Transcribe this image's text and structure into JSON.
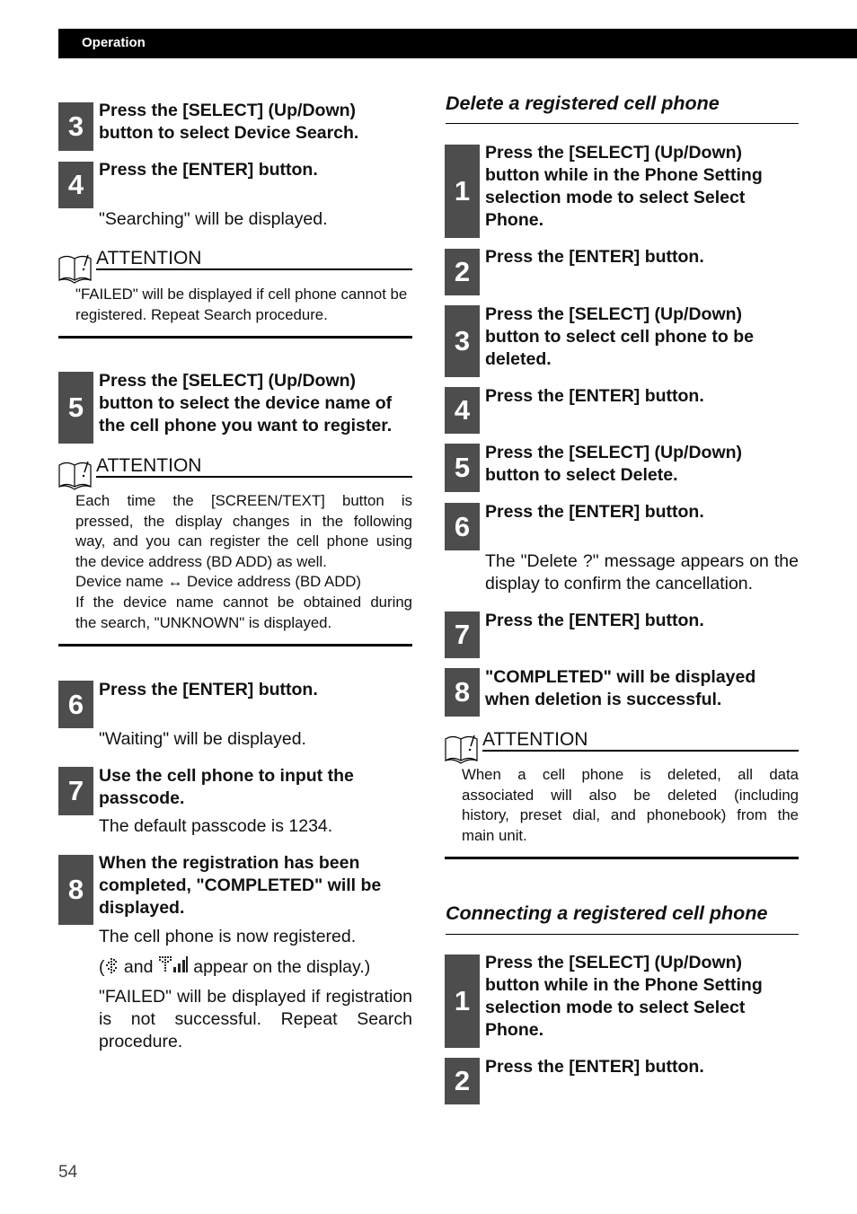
{
  "header": {
    "title": "Operation"
  },
  "left_column": {
    "steps": [
      {
        "number": "3",
        "text": "Press the [SELECT] (Up/Down) button to select Device Search."
      },
      {
        "number": "4",
        "text": "Press the [ENTER] button.",
        "note": "\"Searching\" will be displayed."
      },
      {
        "number": "5",
        "text": "Press the [SELECT] (Up/Down) button to select the device name of the cell phone you want to register."
      },
      {
        "number": "6",
        "text": "Press the [ENTER] button.",
        "note": "\"Waiting\" will be displayed."
      },
      {
        "number": "7",
        "text": "Use the cell phone to input the passcode.",
        "note": "The default passcode is 1234."
      },
      {
        "number": "8",
        "text": "When the registration has been completed, \"COMPLETED\" will be displayed.",
        "note": "The cell phone is now registered.",
        "icons_note": {
          "prefix": "(",
          "middle": " and ",
          "suffix": " appear on the display.)"
        },
        "note2": "\"FAILED\" will be displayed if registration is not successful. Repeat Search procedure."
      }
    ],
    "attention_1": {
      "label": "ATTENTION",
      "text": "\"FAILED\" will be displayed if cell phone cannot be registered. Repeat Search procedure."
    },
    "attention_2": {
      "label": "ATTENTION",
      "lines": [
        "Each time the [SCREEN/TEXT] button is",
        "pressed, the display changes in the following",
        "way, and you can register the cell phone using",
        "the device address (BD ADD) as well.",
        "Device name ↔ Device address (BD ADD)",
        "If the device name cannot be obtained during",
        "the search, \"UNKNOWN\" is displayed."
      ]
    }
  },
  "right_column": {
    "delete_section": {
      "title": "Delete a registered cell phone",
      "steps": [
        {
          "number": "1",
          "text": "Press the [SELECT] (Up/Down) button while in the Phone Setting selection mode to select Select Phone."
        },
        {
          "number": "2",
          "text": "Press the [ENTER] button."
        },
        {
          "number": "3",
          "text": "Press the [SELECT] (Up/Down) button to select cell phone to be deleted."
        },
        {
          "number": "4",
          "text": "Press the [ENTER] button."
        },
        {
          "number": "5",
          "text": "Press the [SELECT] (Up/Down) button to select Delete."
        },
        {
          "number": "6",
          "text": "Press the [ENTER] button.",
          "note": "The \"Delete ?\" message appears on the display to confirm the cancellation."
        },
        {
          "number": "7",
          "text": "Press the [ENTER] button."
        },
        {
          "number": "8",
          "text": "\"COMPLETED\" will be displayed when deletion is successful."
        }
      ],
      "attention": {
        "label": "ATTENTION",
        "lines": [
          "When a cell phone is deleted, all data",
          "associated will also be deleted (including",
          "history, preset dial, and phonebook) from the",
          "main unit."
        ]
      }
    },
    "connect_section": {
      "title": "Connecting a registered cell phone",
      "steps": [
        {
          "number": "1",
          "text": "Press the [SELECT] (Up/Down) button while in the Phone Setting selection mode to select Select Phone."
        },
        {
          "number": "2",
          "text": "Press the [ENTER] button."
        }
      ]
    }
  },
  "footer": {
    "page_number": "54"
  },
  "colors": {
    "badge": "#4d4d4d",
    "header_bar": "#000000"
  }
}
